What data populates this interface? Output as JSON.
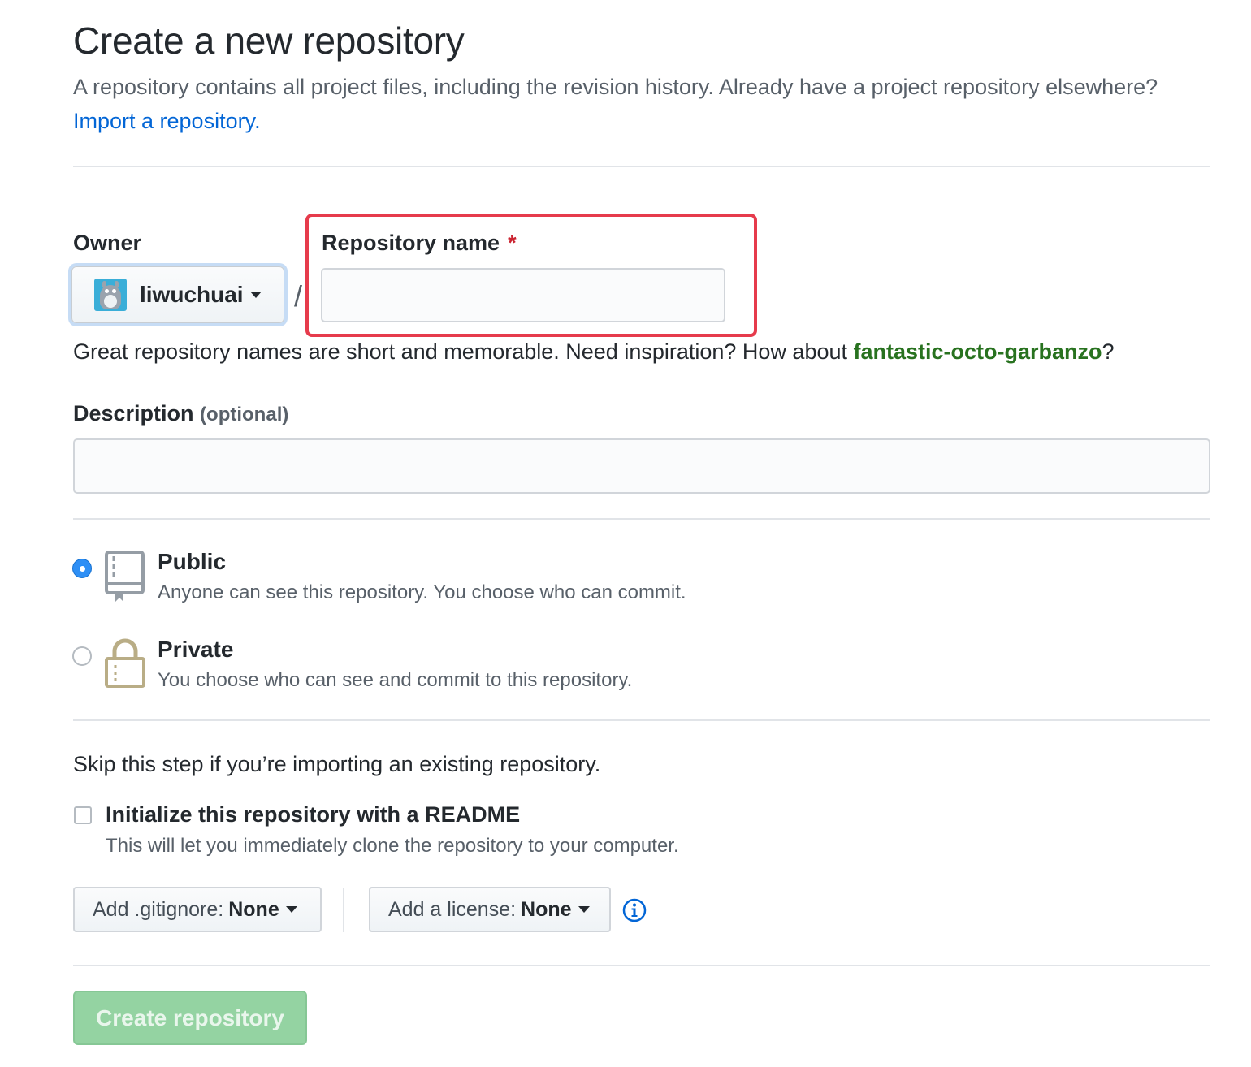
{
  "header": {
    "title": "Create a new repository",
    "subtitle": "A repository contains all project files, including the revision history. Already have a project repository elsewhere?",
    "import_link": "Import a repository."
  },
  "owner": {
    "label": "Owner",
    "username": "liwuchuai",
    "avatar_icon": "totoro-avatar-icon"
  },
  "separator": "/",
  "repo_name": {
    "label": "Repository name",
    "required_mark": "*",
    "value": "",
    "highlight_color": "#e63b4c"
  },
  "name_hint": {
    "prefix": "Great repository names are short and memorable. Need inspiration? How about",
    "suggestion": "fantastic-octo-garbanzo",
    "suffix": "?"
  },
  "description": {
    "label": "Description",
    "optional": "(optional)",
    "value": ""
  },
  "visibility": {
    "selected": "public",
    "public": {
      "title": "Public",
      "desc": "Anyone can see this repository. You choose who can commit.",
      "icon": "repo-book-icon"
    },
    "private": {
      "title": "Private",
      "desc": "You choose who can see and commit to this repository.",
      "icon": "lock-icon"
    }
  },
  "init": {
    "skip_text": "Skip this step if you’re importing an existing repository.",
    "readme_label": "Initialize this repository with a README",
    "readme_desc": "This will let you immediately clone the repository to your computer.",
    "readme_checked": false
  },
  "selects": {
    "gitignore_prefix": "Add .gitignore:",
    "gitignore_value": "None",
    "license_prefix": "Add a license:",
    "license_value": "None"
  },
  "submit": {
    "label": "Create repository",
    "enabled": false,
    "color": "#94d3a2"
  }
}
